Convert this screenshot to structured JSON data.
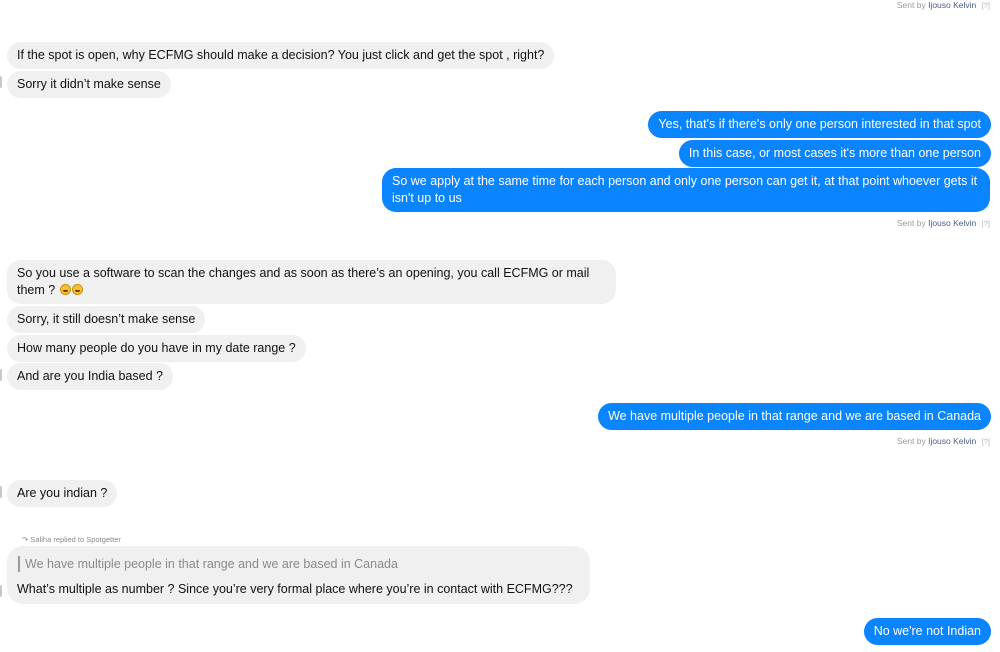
{
  "sent_prefix": "Sent by",
  "sender": "Ijouso Kelvin",
  "info_marker": "[?]",
  "messages": {
    "m1": "If the spot is open, why ECFMG should make a decision? You just click and get the spot , right?",
    "m2": "Sorry it didn’t make sense",
    "m3": "Yes, that's if there's only one person interested in that spot",
    "m4": "In this case, or most cases it's more than one person",
    "m5": "So we apply at the same time for each person and only one person can get it, at that point whoever gets it isn't up to us",
    "m6": "So you use a software to scan the changes and as soon as there’s an opening, you call ECFMG or mail them ?",
    "m7": "Sorry, it still doesn’t make sense",
    "m8": "How many people do you have in my date range ?",
    "m9": "And are you India based ?",
    "m10": "We have multiple people in that range and we are based in Canada",
    "m11": "Are you indian ?",
    "m12": "What’s multiple as number ? Since you’re very formal place where you’re in contact with ECFMG???",
    "m13": "No we're not Indian"
  },
  "reply": {
    "meta": "Saliha replied to Spotgetter",
    "quoted": "We have multiple people in that range and we are based in Canada"
  },
  "emoji_names": [
    "laughing-emoji",
    "laughing-emoji"
  ],
  "colors": {
    "outgoing_bubble": "#0a84ff",
    "incoming_bubble": "#f0f0f0",
    "sender_link": "#4b5f8a"
  }
}
